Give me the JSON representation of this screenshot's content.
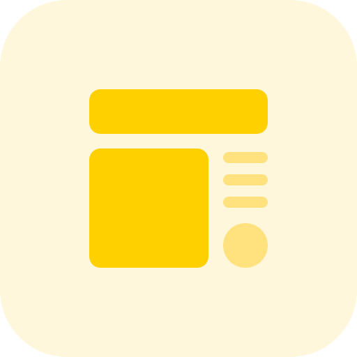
{
  "icon": {
    "name": "layout-icon",
    "colors": {
      "tile_background": "#fff7dc",
      "accent": "#ffd000",
      "accent_soft": "#ffe27d"
    }
  }
}
